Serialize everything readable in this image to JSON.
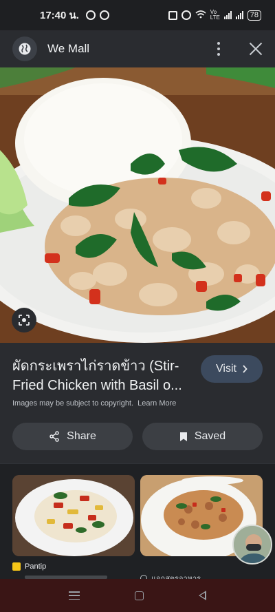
{
  "status_bar": {
    "time": "17:40 น.",
    "battery": "78",
    "network_label": "Vo LTE"
  },
  "app_bar": {
    "title": "We Mall",
    "globe_icon": "globe-icon",
    "more_icon": "more-vert-icon",
    "close_icon": "close-icon"
  },
  "result": {
    "title": "ผัดกระเพราไก่ราดข้าว (Stir-Fried Chicken with Basil o...",
    "visit_label": "Visit",
    "copyright_text": "Images may be subject to copyright.",
    "learn_more": "Learn More",
    "share_label": "Share",
    "saved_label": "Saved"
  },
  "related": [
    {
      "source": "Pantip"
    },
    {
      "source": "แจกสูตรอาหาร"
    }
  ],
  "colors": {
    "accent_button": "#3c4a5e",
    "background": "#1f2124",
    "surface": "#2a2c30"
  }
}
